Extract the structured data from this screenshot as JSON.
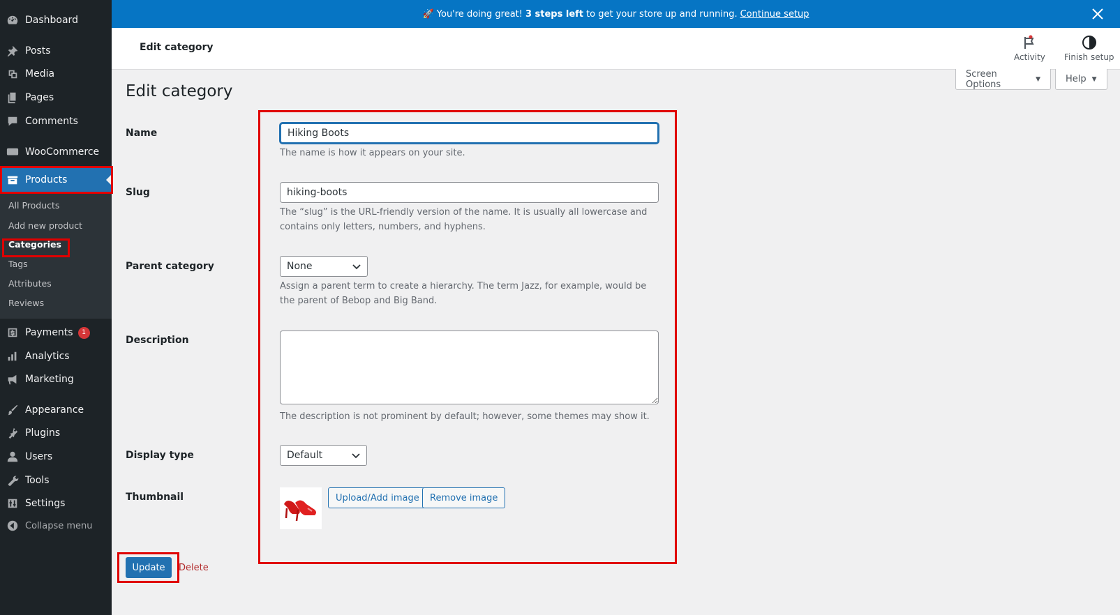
{
  "sidebar": {
    "items": [
      {
        "label": "Dashboard",
        "icon": "dashboard-icon"
      },
      {
        "label": "Posts",
        "icon": "pin-icon"
      },
      {
        "label": "Media",
        "icon": "media-icon"
      },
      {
        "label": "Pages",
        "icon": "pages-icon"
      },
      {
        "label": "Comments",
        "icon": "comment-icon"
      },
      {
        "label": "WooCommerce",
        "icon": "woo-icon"
      },
      {
        "label": "Products",
        "icon": "archive-icon"
      },
      {
        "label": "Payments",
        "icon": "dollar-icon",
        "badge": "1"
      },
      {
        "label": "Analytics",
        "icon": "chart-bar-icon"
      },
      {
        "label": "Marketing",
        "icon": "megaphone-icon"
      },
      {
        "label": "Appearance",
        "icon": "brush-icon"
      },
      {
        "label": "Plugins",
        "icon": "plugin-icon"
      },
      {
        "label": "Users",
        "icon": "user-icon"
      },
      {
        "label": "Tools",
        "icon": "wrench-icon"
      },
      {
        "label": "Settings",
        "icon": "sliders-icon"
      }
    ],
    "submenu": [
      "All Products",
      "Add new product",
      "Categories",
      "Tags",
      "Attributes",
      "Reviews"
    ],
    "collapse_label": "Collapse menu"
  },
  "notice": {
    "prefix": "🚀 You're doing great!",
    "bold": "3 steps left",
    "middle": "to get your store up and running.",
    "link": "Continue setup"
  },
  "header": {
    "title": "Edit category",
    "activity_label": "Activity",
    "finish_setup_label": "Finish setup"
  },
  "screen_options_label": "Screen Options",
  "help_label": "Help",
  "page_title": "Edit category",
  "form": {
    "name_label": "Name",
    "name_value": "Hiking Boots",
    "name_help": "The name is how it appears on your site.",
    "slug_label": "Slug",
    "slug_value": "hiking-boots",
    "slug_help": "The “slug” is the URL-friendly version of the name. It is usually all lowercase and contains only letters, numbers, and hyphens.",
    "parent_label": "Parent category",
    "parent_value": "None",
    "parent_help": "Assign a parent term to create a hierarchy. The term Jazz, for example, would be the parent of Bebop and Big Band.",
    "description_label": "Description",
    "description_value": "",
    "description_help": "The description is not prominent by default; however, some themes may show it.",
    "display_type_label": "Display type",
    "display_type_value": "Default",
    "thumbnail_label": "Thumbnail",
    "upload_label": "Upload/Add image",
    "remove_label": "Remove image"
  },
  "actions": {
    "update_label": "Update",
    "delete_label": "Delete"
  },
  "colors": {
    "sidebar_bg": "#1d2327",
    "accent": "#2271b1",
    "notice_bg": "#0675c4",
    "highlight": "#e00000",
    "delete": "#b32d2e"
  }
}
